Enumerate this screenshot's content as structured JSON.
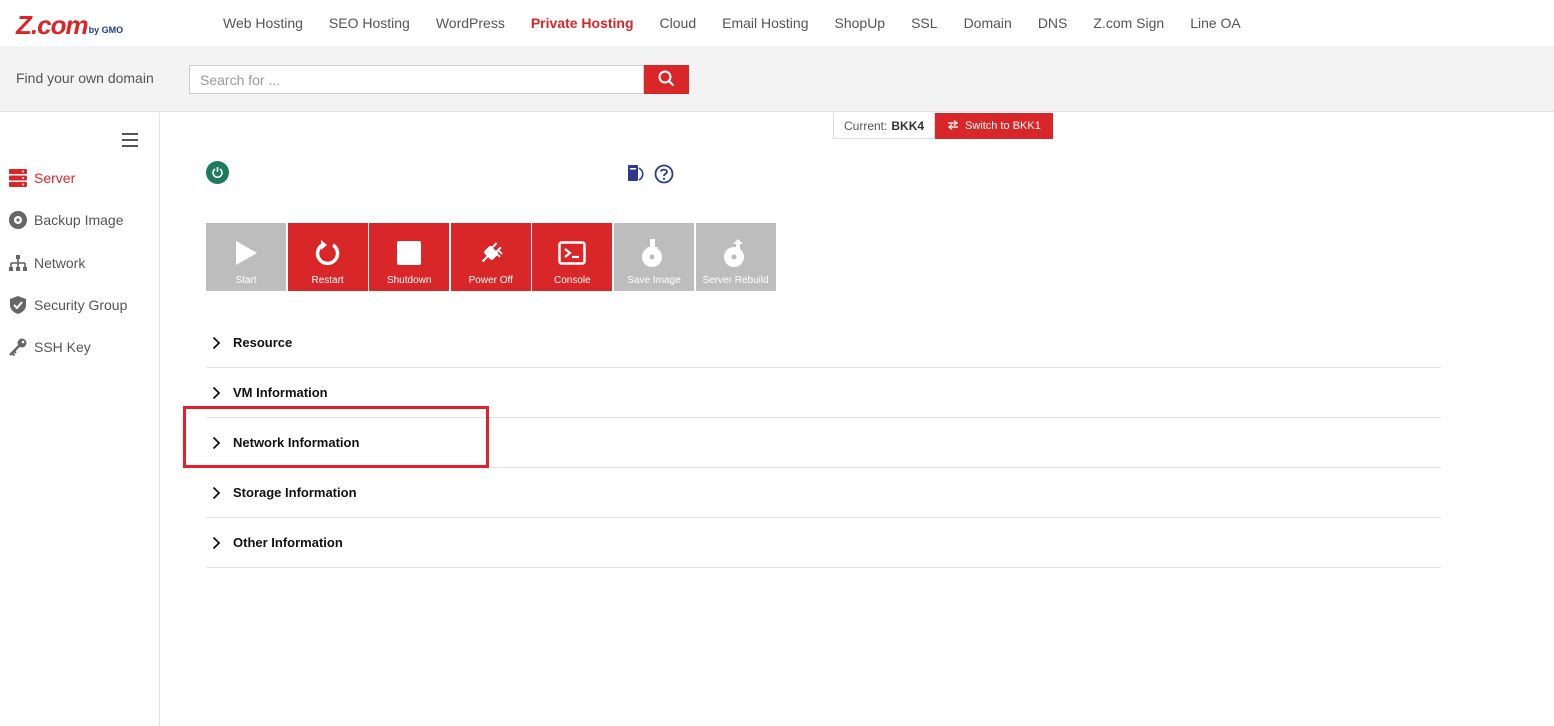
{
  "brand": {
    "logo_main": "Z.com",
    "logo_sub": "by GMO"
  },
  "nav": {
    "items": [
      {
        "label": "Web Hosting"
      },
      {
        "label": "SEO Hosting"
      },
      {
        "label": "WordPress"
      },
      {
        "label": "Private Hosting"
      },
      {
        "label": "Cloud"
      },
      {
        "label": "Email Hosting"
      },
      {
        "label": "ShopUp"
      },
      {
        "label": "SSL"
      },
      {
        "label": "Domain"
      },
      {
        "label": "DNS"
      },
      {
        "label": "Z.com Sign"
      },
      {
        "label": "Line OA"
      }
    ],
    "active": "Private Hosting"
  },
  "search": {
    "label": "Find your own domain",
    "placeholder": "Search for ..."
  },
  "sidebar": {
    "items": [
      {
        "label": "Server",
        "icon": "server-icon"
      },
      {
        "label": "Backup Image",
        "icon": "disc-icon"
      },
      {
        "label": "Network",
        "icon": "network-icon"
      },
      {
        "label": "Security Group",
        "icon": "shield-icon"
      },
      {
        "label": "SSH Key",
        "icon": "key-icon"
      }
    ],
    "active": "Server"
  },
  "region": {
    "current_label": "Current:",
    "current_value": "BKK4",
    "switch_label": "Switch to BKK1"
  },
  "actions": [
    {
      "label": "Start",
      "state": "disabled"
    },
    {
      "label": "Restart",
      "state": "enabled"
    },
    {
      "label": "Shutdown",
      "state": "enabled"
    },
    {
      "label": "Power Off",
      "state": "enabled"
    },
    {
      "label": "Console",
      "state": "enabled"
    },
    {
      "label": "Save Image",
      "state": "disabled"
    },
    {
      "label": "Server Rebuild",
      "state": "disabled"
    }
  ],
  "sections": [
    {
      "label": "Resource"
    },
    {
      "label": "VM Information"
    },
    {
      "label": "Network Information"
    },
    {
      "label": "Storage Information"
    },
    {
      "label": "Other Information"
    }
  ],
  "colors": {
    "accent": "#d92628",
    "power_on": "#1d7a5e",
    "disabled": "#bdbdbd",
    "highlight": "#e3202c"
  }
}
